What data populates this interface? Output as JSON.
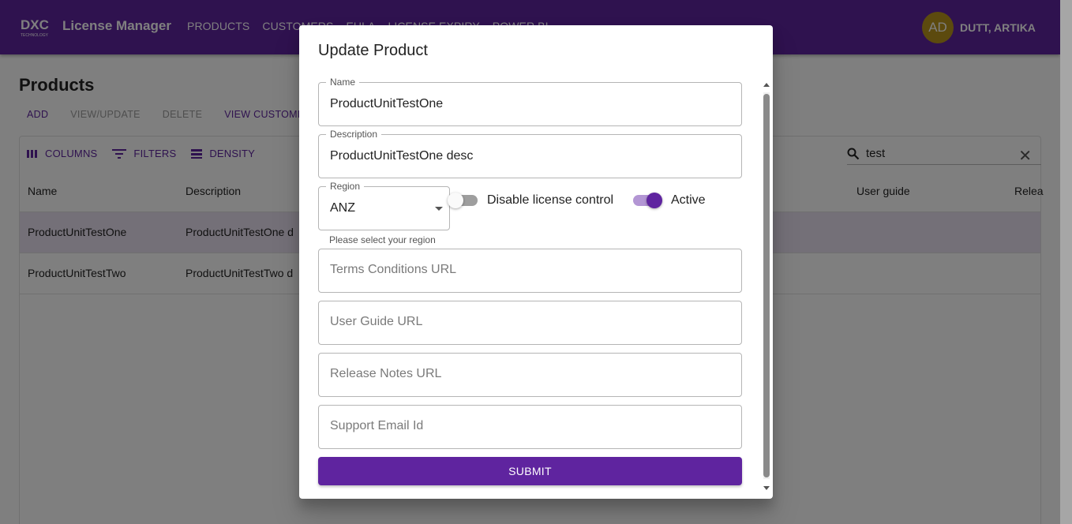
{
  "app": {
    "logo_icon": "dxc-technology-logo",
    "title": "License Manager",
    "nav": [
      "PRODUCTS",
      "CUSTOMERS",
      "EULA",
      "LICENSE EXPIRY",
      "POWER BI"
    ],
    "user": {
      "initials": "AD",
      "name": "DUTT, ARTIKA"
    }
  },
  "page": {
    "title": "Products",
    "actions": [
      {
        "label": "ADD",
        "enabled": true
      },
      {
        "label": "VIEW/UPDATE",
        "enabled": false
      },
      {
        "label": "DELETE",
        "enabled": false
      },
      {
        "label": "VIEW CUSTOMERS",
        "enabled": true
      }
    ]
  },
  "grid": {
    "toolbar": {
      "columns": "COLUMNS",
      "filters": "FILTERS",
      "density": "DENSITY"
    },
    "search_value": "test",
    "columns": [
      "Name",
      "Description",
      "User guide",
      "Relea"
    ],
    "rows": [
      {
        "name": "ProductUnitTestOne",
        "description": "ProductUnitTestOne d",
        "selected": true
      },
      {
        "name": "ProductUnitTestTwo",
        "description": "ProductUnitTestTwo d",
        "selected": false
      }
    ]
  },
  "dialog": {
    "title": "Update Product",
    "name": {
      "label": "Name",
      "value": "ProductUnitTestOne"
    },
    "description": {
      "label": "Description",
      "value": "ProductUnitTestOne desc"
    },
    "region": {
      "label": "Region",
      "value": "ANZ",
      "helper": "Please select your region"
    },
    "disable_license_control": {
      "label": "Disable license control",
      "checked": false
    },
    "active": {
      "label": "Active",
      "checked": true
    },
    "terms_url": {
      "placeholder": "Terms Conditions URL"
    },
    "user_guide_url": {
      "placeholder": "User Guide URL"
    },
    "release_notes_url": {
      "placeholder": "Release Notes URL"
    },
    "support_email": {
      "placeholder": "Support Email Id"
    },
    "submit_label": "SUBMIT"
  },
  "colors": {
    "brand": "#5f249f",
    "avatar": "#b9941c",
    "switch_off_track": "#9e9e9e"
  }
}
